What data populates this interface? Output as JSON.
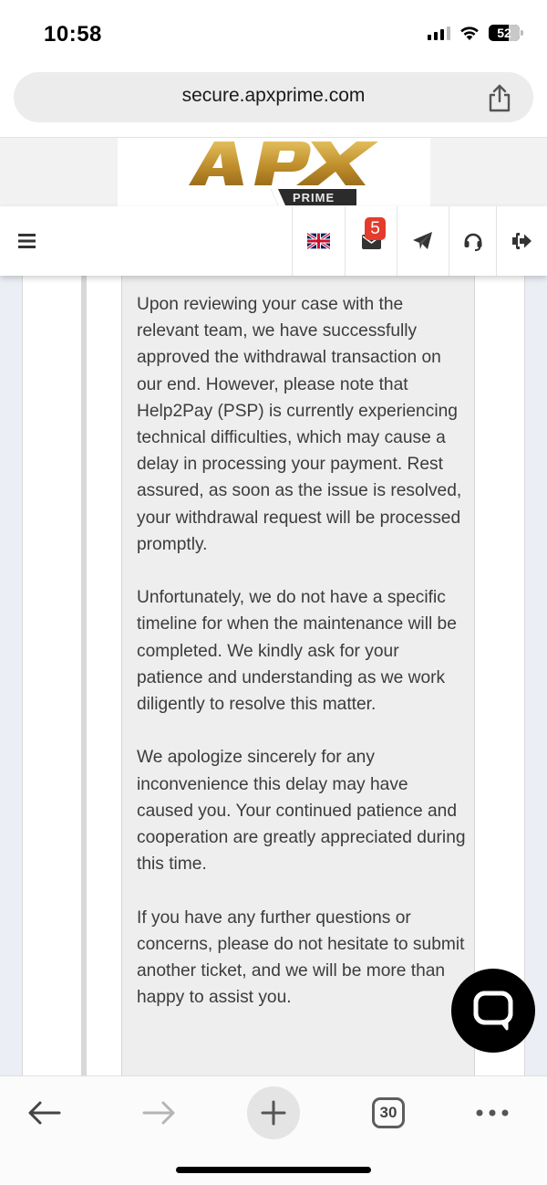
{
  "status_bar": {
    "time": "10:58",
    "battery": "52",
    "icons": [
      "signal-icon",
      "wifi-icon",
      "battery-icon"
    ]
  },
  "browser": {
    "url": "secure.apxprime.com",
    "share_icon": "share-icon"
  },
  "site": {
    "logo_main": "APX",
    "logo_sub": "PRIME",
    "brand_colors": {
      "gold": "#c89a3a",
      "dark": "#2a2a2a"
    },
    "nav": {
      "menu_icon": "hamburger-menu-icon",
      "items": [
        {
          "name": "language-flag-uk",
          "icon": "uk-flag-icon"
        },
        {
          "name": "messages",
          "icon": "envelope-icon",
          "badge": "5"
        },
        {
          "name": "send",
          "icon": "paper-plane-icon"
        },
        {
          "name": "support",
          "icon": "headset-icon"
        },
        {
          "name": "logout",
          "icon": "sign-out-icon"
        }
      ],
      "badge_color": "#e53b2c"
    }
  },
  "message": {
    "paragraphs": [
      "Upon reviewing your case with the relevant team, we have successfully approved the withdrawal transaction on our end. However, please note that Help2Pay (PSP) is currently experiencing technical difficulties, which may cause a delay in processing your payment. Rest assured, as soon as the issue is resolved, your withdrawal request will be processed promptly.",
      "Unfortunately, we do not have a specific timeline for when the maintenance will be completed. We kindly ask for your patience and understanding as we work diligently to resolve this matter.",
      "We apologize sincerely for any inconvenience this delay may have caused you. Your continued patience and cooperation are greatly appreciated during this time.",
      "If you have any further questions or concerns, please do not hesitate to submit another ticket, and we will be more than happy to assist you."
    ]
  },
  "chat_fab": {
    "icon": "chat-bubble-icon"
  },
  "toolbar": {
    "back_icon": "arrow-left-icon",
    "forward_icon": "arrow-right-icon",
    "new_tab_icon": "plus-icon",
    "tab_count": "30",
    "more_icon": "more-dots-icon"
  }
}
